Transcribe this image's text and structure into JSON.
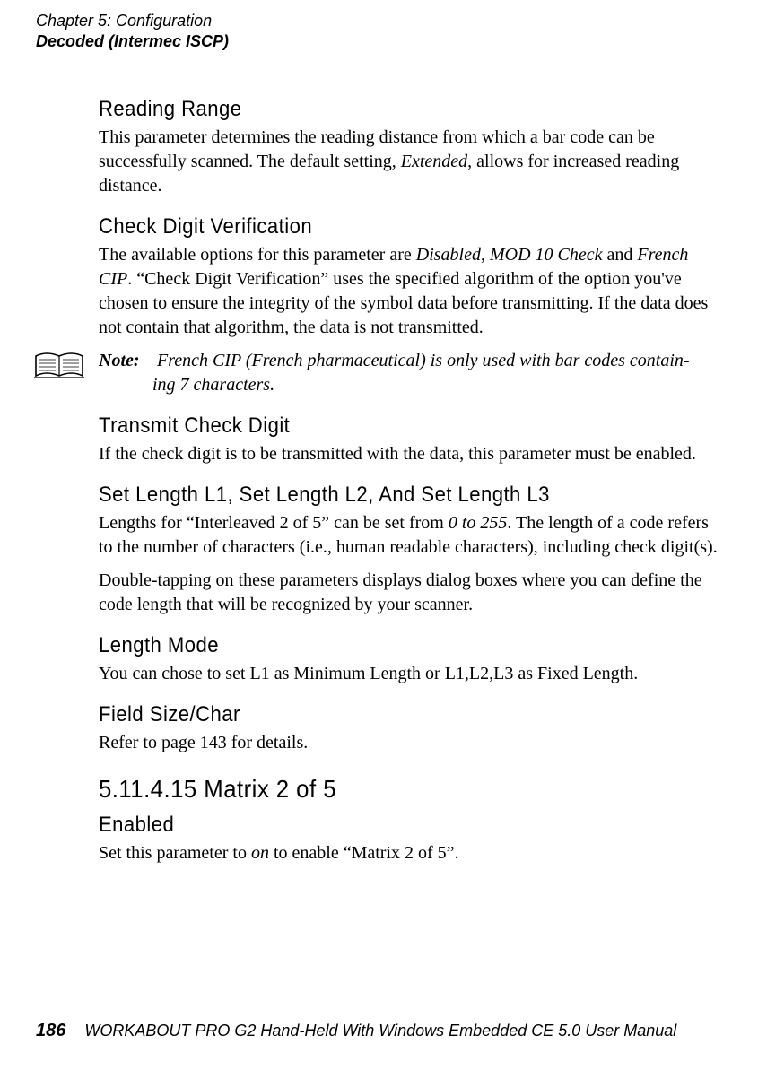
{
  "header": {
    "line1": "Chapter 5: Configuration",
    "line2": "Decoded (Intermec ISCP)"
  },
  "sections": {
    "reading_range": {
      "title": "Reading Range",
      "p1a": "This parameter determines the reading distance from which a bar code can be successfully scanned. The default setting, ",
      "p1_em": "Extended",
      "p1b": ", allows for increased reading distance."
    },
    "check_digit": {
      "title": "Check Digit Verification",
      "p1a": "The available options for this parameter are ",
      "em1": "Disabled",
      "sep1": ", ",
      "em2": "MOD 10 Check",
      "sep2": " and ",
      "em3": "French CIP",
      "p1b": ". “Check Digit Verification” uses the specified algorithm of the option you've chosen to ensure the integrity of the symbol data before transmitting. If the data does not contain that algorithm, the data is not transmitted."
    },
    "note": {
      "label": "Note:",
      "text1": "French CIP (French pharmaceutical) is only used with bar codes contain-",
      "text2": "ing 7 characters."
    },
    "transmit": {
      "title": "Transmit Check Digit",
      "p1": "If the check digit is to be transmitted with the data, this parameter must be enabled."
    },
    "set_length": {
      "title": "Set Length L1, Set Length L2, And Set Length L3",
      "p1a": "Lengths for “Interleaved 2 of 5” can be set from ",
      "em1": "0 to 255",
      "p1b": ". The length of a code refers to the number of characters (i.e., human readable characters), including check digit(s).",
      "p2": "Double-tapping on these parameters displays dialog boxes where you can define the code length that will be recognized by your scanner."
    },
    "length_mode": {
      "title": "Length Mode",
      "p1": "You can chose to set L1 as Minimum Length or L1,L2,L3 as Fixed Length."
    },
    "field_size": {
      "title": "Field Size/Char",
      "p1": "Refer to page 143 for details."
    },
    "matrix": {
      "title": "5.11.4.15  Matrix 2 of 5",
      "enabled_title": "Enabled",
      "p1a": "Set this parameter to ",
      "em1": "on",
      "p1b": " to enable “Matrix 2 of 5”."
    }
  },
  "footer": {
    "page_number": "186",
    "title": "WORKABOUT PRO G2 Hand-Held With Windows Embedded CE 5.0 User Manual"
  }
}
